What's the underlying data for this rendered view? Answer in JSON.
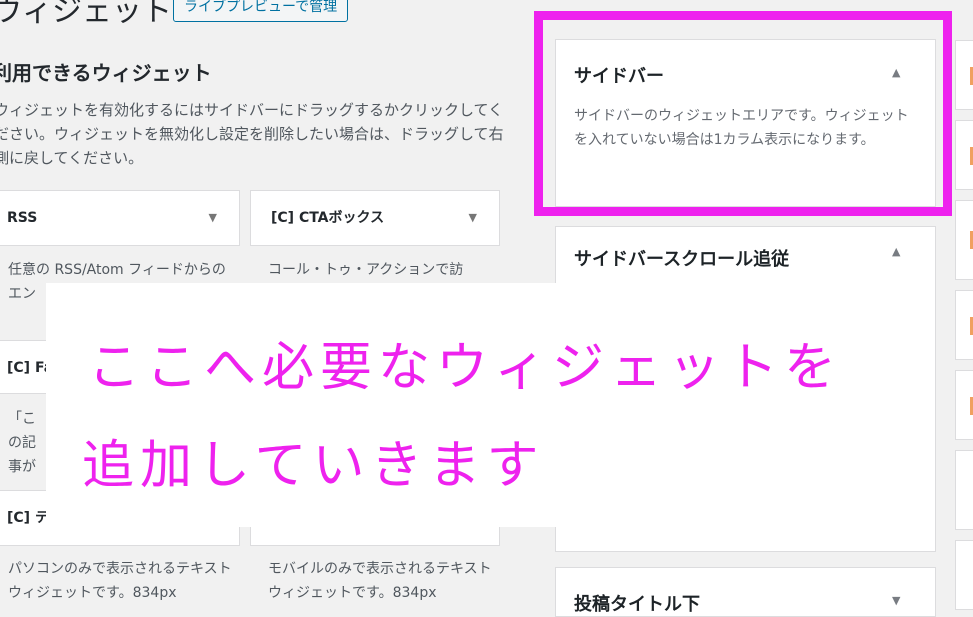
{
  "header": {
    "title": "ウィジェット",
    "live_preview_button": "ライブプレビューで管理"
  },
  "available": {
    "title": "利用できるウィジェット",
    "description": "ウィジェットを有効化するにはサイドバーにドラッグするかクリックしてください。ウィジェットを無効化し設定を削除したい場合は、ドラッグして右側に戻してください。",
    "widgets": [
      {
        "name": "RSS",
        "desc": "任意の RSS/Atom フィードからのエン"
      },
      {
        "name": "[C] CTAボックス",
        "desc": "コール・トゥ・アクションで訪"
      },
      {
        "name": "[C] Fa",
        "desc": "「この記事が気に入ったら ね！しよう。」ボックスを表示しま す。"
      },
      {
        "name": "[C] テ",
        "desc": "パソコンのみで表示されるテキストウィジェットです。834px"
      },
      {
        "name": "",
        "desc": "モバイルのみで表示されるテキストウィジェットです。834px"
      }
    ]
  },
  "sidebars": [
    {
      "title": "サイドバー",
      "desc": "サイドバーのウィジェットエリアです。ウィジェットを入れていない場合は1カラム表示になります。"
    },
    {
      "title": "サイドバースクロール追従"
    },
    {
      "title": "投稿タイトル下"
    }
  ],
  "overlay": {
    "line1": "ここへ必要なウィジェットを",
    "line2": "追加していきます"
  },
  "colors": {
    "highlight": "#ee22ee",
    "accent_link": "#0071a1"
  },
  "icons": {
    "collapse": "triangle-up",
    "expand": "triangle-down"
  }
}
